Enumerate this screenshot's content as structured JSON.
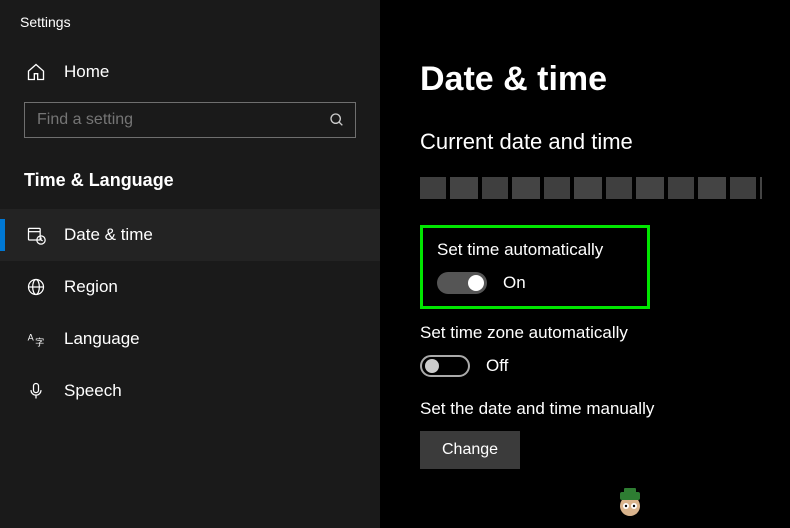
{
  "app": {
    "title": "Settings"
  },
  "sidebar": {
    "home_label": "Home",
    "search_placeholder": "Find a setting",
    "category_label": "Time & Language",
    "items": [
      {
        "label": "Date & time"
      },
      {
        "label": "Region"
      },
      {
        "label": "Language"
      },
      {
        "label": "Speech"
      }
    ]
  },
  "main": {
    "page_title": "Date & time",
    "current_section": "Current date and time",
    "set_time_auto": {
      "label": "Set time automatically",
      "state": "On"
    },
    "set_zone_auto": {
      "label": "Set time zone automatically",
      "state": "Off"
    },
    "manual_label": "Set the date and time manually",
    "change_button": "Change"
  }
}
